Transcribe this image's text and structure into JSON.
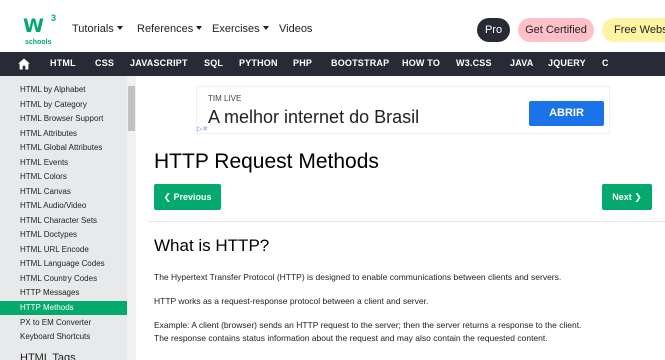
{
  "logo": {
    "mark": "W",
    "superscript": "3",
    "subtitle": "schools"
  },
  "topnav": {
    "tutorials": "Tutorials",
    "references": "References",
    "exercises": "Exercises",
    "videos": "Videos",
    "pro": "Pro",
    "get_certified": "Get Certified",
    "free_website": "Free Website"
  },
  "darknav": [
    "HTML",
    "CSS",
    "JAVASCRIPT",
    "SQL",
    "PYTHON",
    "PHP",
    "BOOTSTRAP",
    "HOW TO",
    "W3.CSS",
    "JAVA",
    "JQUERY",
    "C"
  ],
  "sidebar": {
    "items": [
      "HTML by Alphabet",
      "HTML by Category",
      "HTML Browser Support",
      "HTML Attributes",
      "HTML Global Attributes",
      "HTML Events",
      "HTML Colors",
      "HTML Canvas",
      "HTML Audio/Video",
      "HTML Character Sets",
      "HTML Doctypes",
      "HTML URL Encode",
      "HTML Language Codes",
      "HTML Country Codes",
      "HTTP Messages",
      "HTTP Methods",
      "PX to EM Converter",
      "Keyboard Shortcuts"
    ],
    "selected_index": 15,
    "partial_heading": "HTML Tags"
  },
  "ad": {
    "brand": "TIM LIVE",
    "headline": "A melhor internet do Brasil",
    "button": "ABRIR"
  },
  "main": {
    "title": "HTTP Request Methods",
    "prev": "❮ Previous",
    "next": "Next ❯",
    "section_title": "What is HTTP?",
    "p1": "The Hypertext Transfer Protocol (HTTP) is designed to enable communications between clients and servers.",
    "p2": "HTTP works as a request-response protocol between a client and server.",
    "p3a": "Example: A client (browser) sends an HTTP request to the server; then the server returns a response to the client.",
    "p3b": "The response contains status information about the request and may also contain the requested content."
  },
  "colors": {
    "accent": "#04aa6d",
    "dark_nav": "#282a35",
    "sidebar_bg": "#e7e9eb"
  }
}
